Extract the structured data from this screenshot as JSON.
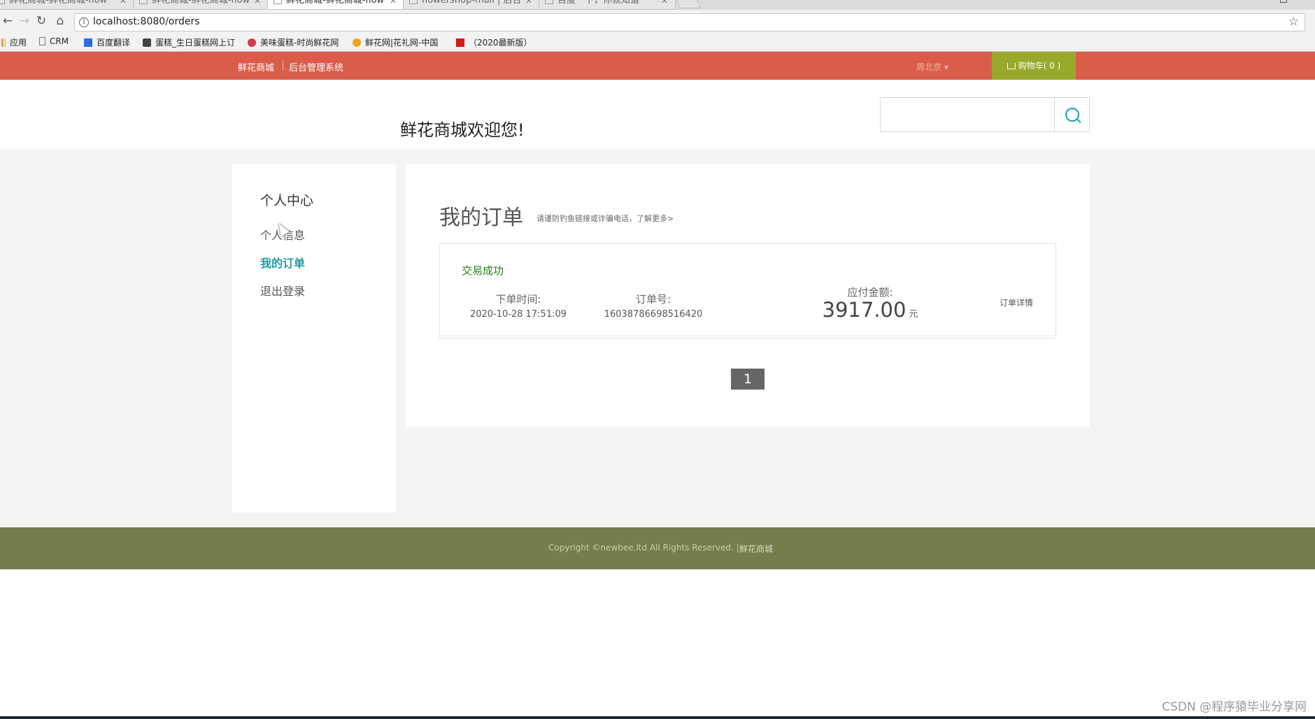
{
  "browser": {
    "tabs": [
      {
        "label": "鲜花商城-鲜花商城-flow",
        "active": false
      },
      {
        "label": "鲜花商城-鲜花商城-flow",
        "active": false
      },
      {
        "label": "鲜花商城-鲜花商城-flow",
        "active": true
      },
      {
        "label": "flowershop-mall | 后台",
        "active": false
      },
      {
        "label": "百度一下，你就知道",
        "active": false
      }
    ],
    "close_glyph": "✕",
    "url": "localhost:8080/orders",
    "bookmarks": [
      "应用",
      "CRM",
      "百度翻译",
      "蛋糕_生日蛋糕网上订",
      "美味蛋糕-时尚鲜花网",
      "鲜花网|花礼网-中国",
      "（2020最新版）"
    ]
  },
  "topbar": {
    "brand": "鲜花商城",
    "admin_link": "后台管理系统",
    "city": "周北京 ▾",
    "cart_label": "购物车( 0 )"
  },
  "header": {
    "welcome": "鲜花商城欢迎您!",
    "search_value": ""
  },
  "sidebar": {
    "title": "个人中心",
    "items": [
      "个人信息",
      "我的订单",
      "退出登录"
    ]
  },
  "main": {
    "title": "我的订单",
    "notice": "请谨防钓鱼链接或诈骗电话，了解更多>",
    "order": {
      "status": "交易成功",
      "time_label": "下单时间:",
      "time_value": "2020-10-28 17:51:09",
      "no_label": "订单号:",
      "no_value": "16038786698516420",
      "amount_label": "应付金额:",
      "amount_value": "3917.00",
      "amount_unit": "元",
      "detail_link": "订单详情"
    },
    "pager": {
      "current": "1"
    }
  },
  "footer": {
    "copyright": "Copyright ©newbee.ltd All Rights Reserved.  |",
    "link": "鲜花商城"
  },
  "watermark": "CSDN @程序猿毕业分享网",
  "colors": {
    "topbar": "#da5d4c",
    "cart": "#9aa82b",
    "accent": "#1f9ea3",
    "status_green": "#2a7a26",
    "footer": "#767c4b"
  }
}
